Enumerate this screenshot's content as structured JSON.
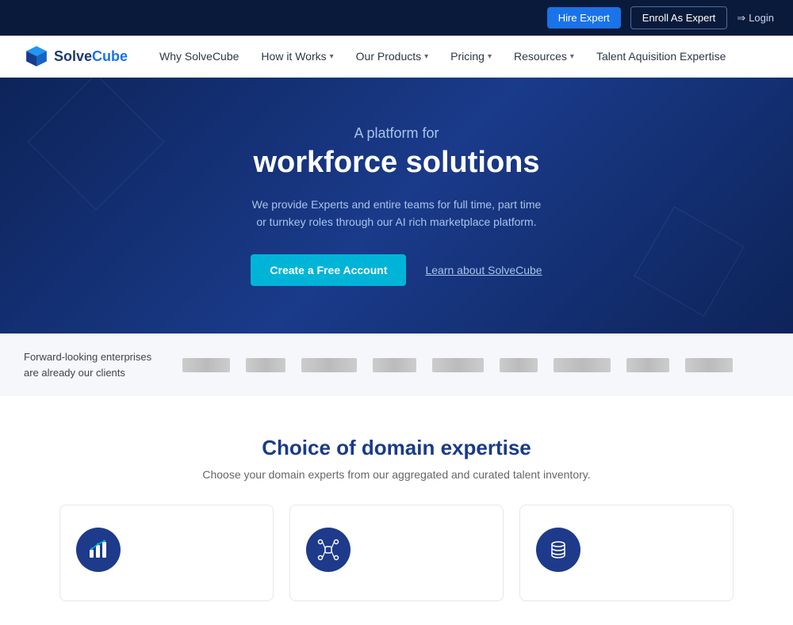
{
  "topbar": {
    "hire_expert_label": "Hire Expert",
    "enroll_label": "Enroll As Expert",
    "login_label": "Login",
    "login_icon": "→"
  },
  "navbar": {
    "logo_text_main": "SolveCube",
    "nav_items": [
      {
        "label": "Why SolveCube",
        "has_dropdown": false
      },
      {
        "label": "How it Works",
        "has_dropdown": true
      },
      {
        "label": "Our Products",
        "has_dropdown": true
      },
      {
        "label": "Pricing",
        "has_dropdown": true
      },
      {
        "label": "Resources",
        "has_dropdown": true
      },
      {
        "label": "Talent Aquisition Expertise",
        "has_dropdown": false
      }
    ]
  },
  "hero": {
    "subtitle": "A platform for",
    "title": "workforce solutions",
    "description": "We provide Experts and entire teams for full time, part time\nor turnkey roles through our AI rich marketplace platform.",
    "cta_primary": "Create a Free Account",
    "cta_secondary": "Learn about SolveCube"
  },
  "clients": {
    "text": "Forward-looking enterprises\nare already our clients"
  },
  "domain": {
    "title": "Choice of domain expertise",
    "description": "Choose your domain experts from our aggregated and curated talent inventory.",
    "cards": [
      {
        "icon": "chart-icon",
        "color": "#1e3a8a"
      },
      {
        "icon": "network-icon",
        "color": "#1e3a8a"
      },
      {
        "icon": "database-icon",
        "color": "#1e3a8a"
      }
    ]
  }
}
